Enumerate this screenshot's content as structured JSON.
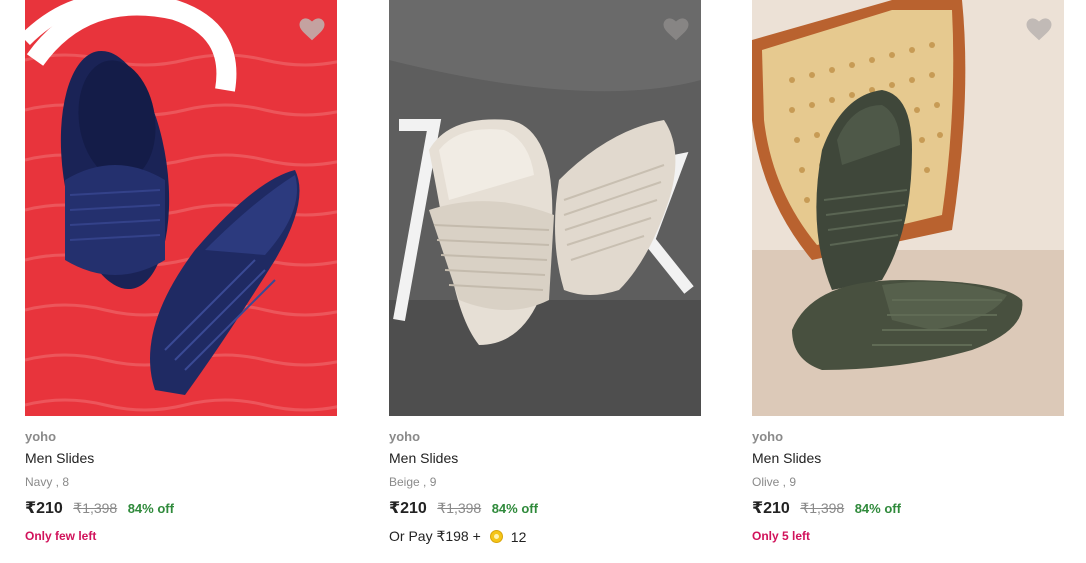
{
  "products": [
    {
      "brand": "yoho",
      "name": "Men Slides",
      "variant": "Navy , 8",
      "price": "₹210",
      "mrp": "₹1,398",
      "discount": "84% off",
      "stock_note": "Only few left",
      "image_icon": "navy-slides-image",
      "bg_color": "#e8343c",
      "product_color": "#1f2a63"
    },
    {
      "brand": "yoho",
      "name": "Men Slides",
      "variant": "Beige , 9",
      "price": "₹210",
      "mrp": "₹1,398",
      "discount": "84% off",
      "or_pay_text": "Or Pay ₹198 +",
      "coins": "12",
      "image_icon": "beige-slides-image",
      "bg_color": "#6b6b6b",
      "product_color": "#e4ddd3"
    },
    {
      "brand": "yoho",
      "name": "Men Slides",
      "variant": "Olive , 9",
      "price": "₹210",
      "mrp": "₹1,398",
      "discount": "84% off",
      "stock_note": "Only 5 left",
      "image_icon": "olive-slides-image",
      "bg_color": "#e9dcd0",
      "product_color": "#4a5240"
    }
  ],
  "colors": {
    "discount_green": "#2f8a3b",
    "stock_pink": "#d1125b",
    "muted_gray": "#8a8a8a",
    "wishlist_gray": "#bdb6b2"
  },
  "icons": {
    "wishlist": "heart-icon",
    "coin": "coin-icon"
  }
}
